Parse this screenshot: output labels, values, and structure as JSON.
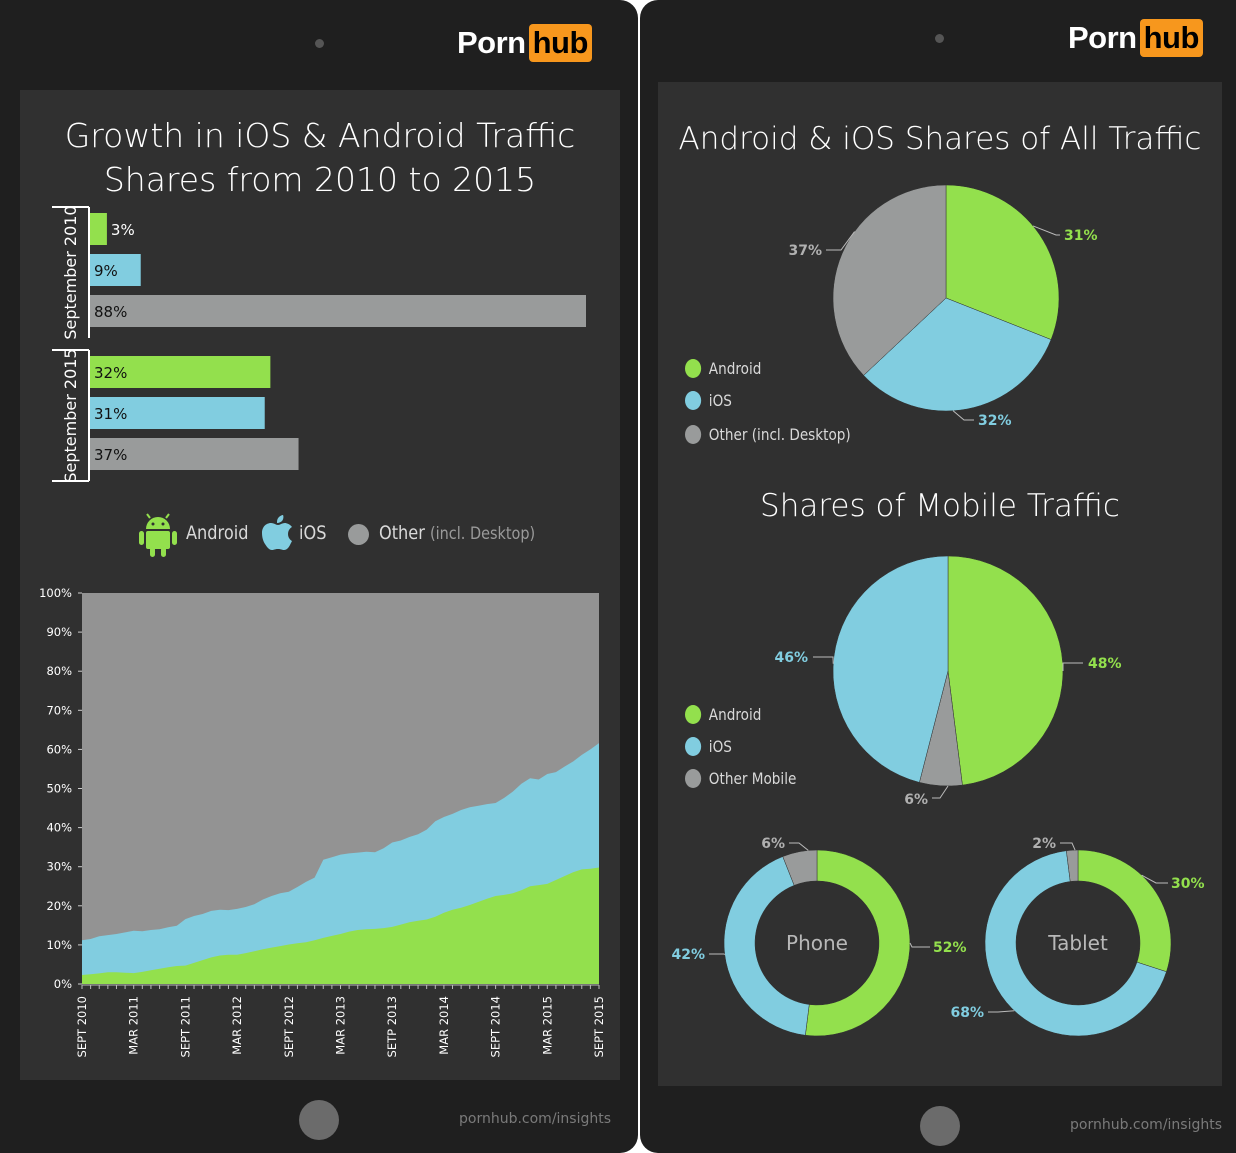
{
  "brand": {
    "logo_left": "Porn",
    "logo_right": "hub",
    "accent_color": "#f7971d",
    "footer_url": "pornhub.com/insights"
  },
  "colors": {
    "android": "#93e04d",
    "ios": "#81cde0",
    "other": "#939393",
    "other_bar": "#999b9b",
    "background": "#303030",
    "bezel": "#1f1f1f"
  },
  "left_panel": {
    "title_line1": "Growth in iOS & Android Traffic",
    "title_line2": "Shares from 2010 to 2015",
    "legend": {
      "android": "Android",
      "ios": "iOS",
      "other": "Other",
      "other_note": "(incl. Desktop)"
    }
  },
  "right_panel": {
    "title_all": "Android & iOS Shares of All Traffic",
    "title_mobile": "Shares of Mobile Traffic",
    "legend_all": [
      "Android",
      "iOS",
      "Other (incl. Desktop)"
    ],
    "legend_mobile": [
      "Android",
      "iOS",
      "Other Mobile"
    ]
  },
  "chart_data": [
    {
      "type": "bar",
      "orientation": "horizontal",
      "title": "Growth in iOS & Android Traffic Shares from 2010 to 2015",
      "groups": [
        {
          "label": "September 2010",
          "series": [
            {
              "name": "Android",
              "value": 3,
              "label": "3%"
            },
            {
              "name": "iOS",
              "value": 9,
              "label": "9%"
            },
            {
              "name": "Other (incl. Desktop)",
              "value": 88,
              "label": "88%"
            }
          ]
        },
        {
          "label": "September 2015",
          "series": [
            {
              "name": "Android",
              "value": 32,
              "label": "32%"
            },
            {
              "name": "iOS",
              "value": 31,
              "label": "31%"
            },
            {
              "name": "Other (incl. Desktop)",
              "value": 37,
              "label": "37%"
            }
          ]
        }
      ],
      "xlim": [
        0,
        88
      ]
    },
    {
      "type": "area",
      "stacked": true,
      "ylim": [
        0,
        100
      ],
      "yticks": [
        "0%",
        "10%",
        "20%",
        "30%",
        "40%",
        "50%",
        "60%",
        "70%",
        "80%",
        "90%",
        "100%"
      ],
      "xtick_labels": [
        "SEPT 2010",
        "MAR 2011",
        "SEPT 2011",
        "MAR 2012",
        "SEPT 2012",
        "MAR 2013",
        "SETP 2013",
        "MAR 2014",
        "SEPT 2014",
        "MAR 2015",
        "SEPT 2015"
      ],
      "x_months": 61,
      "series": [
        {
          "name": "Android",
          "values": [
            2.3,
            2.5,
            2.7,
            3.0,
            3.0,
            2.9,
            2.8,
            3.1,
            3.5,
            3.9,
            4.3,
            4.6,
            4.7,
            5.4,
            6.1,
            6.8,
            7.3,
            7.5,
            7.5,
            7.9,
            8.4,
            8.9,
            9.3,
            9.7,
            10.1,
            10.4,
            10.7,
            11.2,
            11.8,
            12.3,
            12.8,
            13.4,
            13.8,
            14.0,
            14.1,
            14.3,
            14.6,
            15.2,
            15.8,
            16.2,
            16.5,
            17.2,
            18.2,
            19.0,
            19.5,
            20.2,
            21.0,
            21.8,
            22.5,
            22.8,
            23.2,
            24.0,
            25.0,
            25.3,
            25.6,
            26.6,
            27.6,
            28.6,
            29.3,
            29.5,
            29.8
          ]
        },
        {
          "name": "iOS",
          "values": [
            8.9,
            9.0,
            9.5,
            9.5,
            9.8,
            10.3,
            10.8,
            10.4,
            10.3,
            10.1,
            10.2,
            10.3,
            11.9,
            12.0,
            11.8,
            11.9,
            11.7,
            11.4,
            11.7,
            11.8,
            12.0,
            12.7,
            13.2,
            13.5,
            13.5,
            14.4,
            15.4,
            16.0,
            20.0,
            20.1,
            20.3,
            20.0,
            19.8,
            19.8,
            19.6,
            20.4,
            21.6,
            21.5,
            21.8,
            22.1,
            23.0,
            24.4,
            24.5,
            24.5,
            25.0,
            25.0,
            24.6,
            24.2,
            23.8,
            24.8,
            26.0,
            27.2,
            27.6,
            27.0,
            28.1,
            27.6,
            28.0,
            28.3,
            29.3,
            30.5,
            31.8
          ]
        },
        {
          "name": "Other (incl. Desktop)",
          "values": "remainder to 100%"
        }
      ]
    },
    {
      "type": "pie",
      "title": "Android & iOS Shares of All Traffic",
      "slices": [
        {
          "name": "Android",
          "value": 31,
          "label": "31%"
        },
        {
          "name": "iOS",
          "value": 32,
          "label": "32%"
        },
        {
          "name": "Other (incl. Desktop)",
          "value": 37,
          "label": "37%"
        }
      ]
    },
    {
      "type": "pie",
      "title": "Shares of Mobile Traffic",
      "slices": [
        {
          "name": "Android",
          "value": 48,
          "label": "48%"
        },
        {
          "name": "Other Mobile",
          "value": 6,
          "label": "6%"
        },
        {
          "name": "iOS",
          "value": 46,
          "label": "46%"
        }
      ]
    },
    {
      "type": "pie",
      "variant": "donut",
      "center_label": "Phone",
      "slices": [
        {
          "name": "Android",
          "value": 52,
          "label": "52%"
        },
        {
          "name": "iOS",
          "value": 42,
          "label": "42%"
        },
        {
          "name": "Other Mobile",
          "value": 6,
          "label": "6%"
        }
      ]
    },
    {
      "type": "pie",
      "variant": "donut",
      "center_label": "Tablet",
      "slices": [
        {
          "name": "Android",
          "value": 30,
          "label": "30%"
        },
        {
          "name": "iOS",
          "value": 68,
          "label": "68%"
        },
        {
          "name": "Other Mobile",
          "value": 2,
          "label": "2%"
        }
      ]
    }
  ]
}
